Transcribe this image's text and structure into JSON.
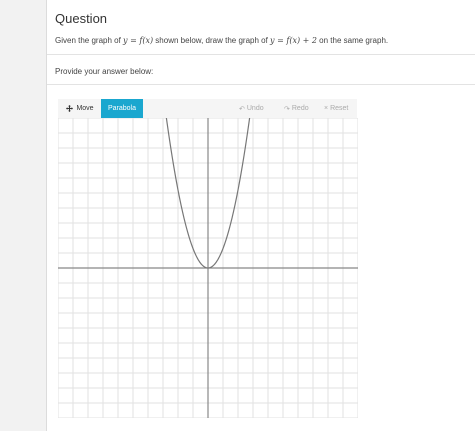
{
  "heading": "Question",
  "question": {
    "part1": "Given the graph of ",
    "math1": "y = f(x)",
    "part2": " shown below, draw the graph of ",
    "math2": "y = f(x) + 2",
    "part3": " on the same graph."
  },
  "prompt": "Provide your answer below:",
  "toolbar": {
    "move_label": "Move",
    "parabola_label": "Parabola",
    "undo_label": "Undo",
    "redo_label": "Redo",
    "reset_label": "Reset",
    "active_color": "#1aa7cf"
  },
  "graph": {
    "x_range": [
      -10,
      10
    ],
    "y_range": [
      -10,
      10
    ],
    "grid_step": 1,
    "curve": "y = f(x)",
    "curve_vertex": [
      0,
      0
    ],
    "curve_coefficient": 1.3,
    "curve_color": "#777777"
  }
}
